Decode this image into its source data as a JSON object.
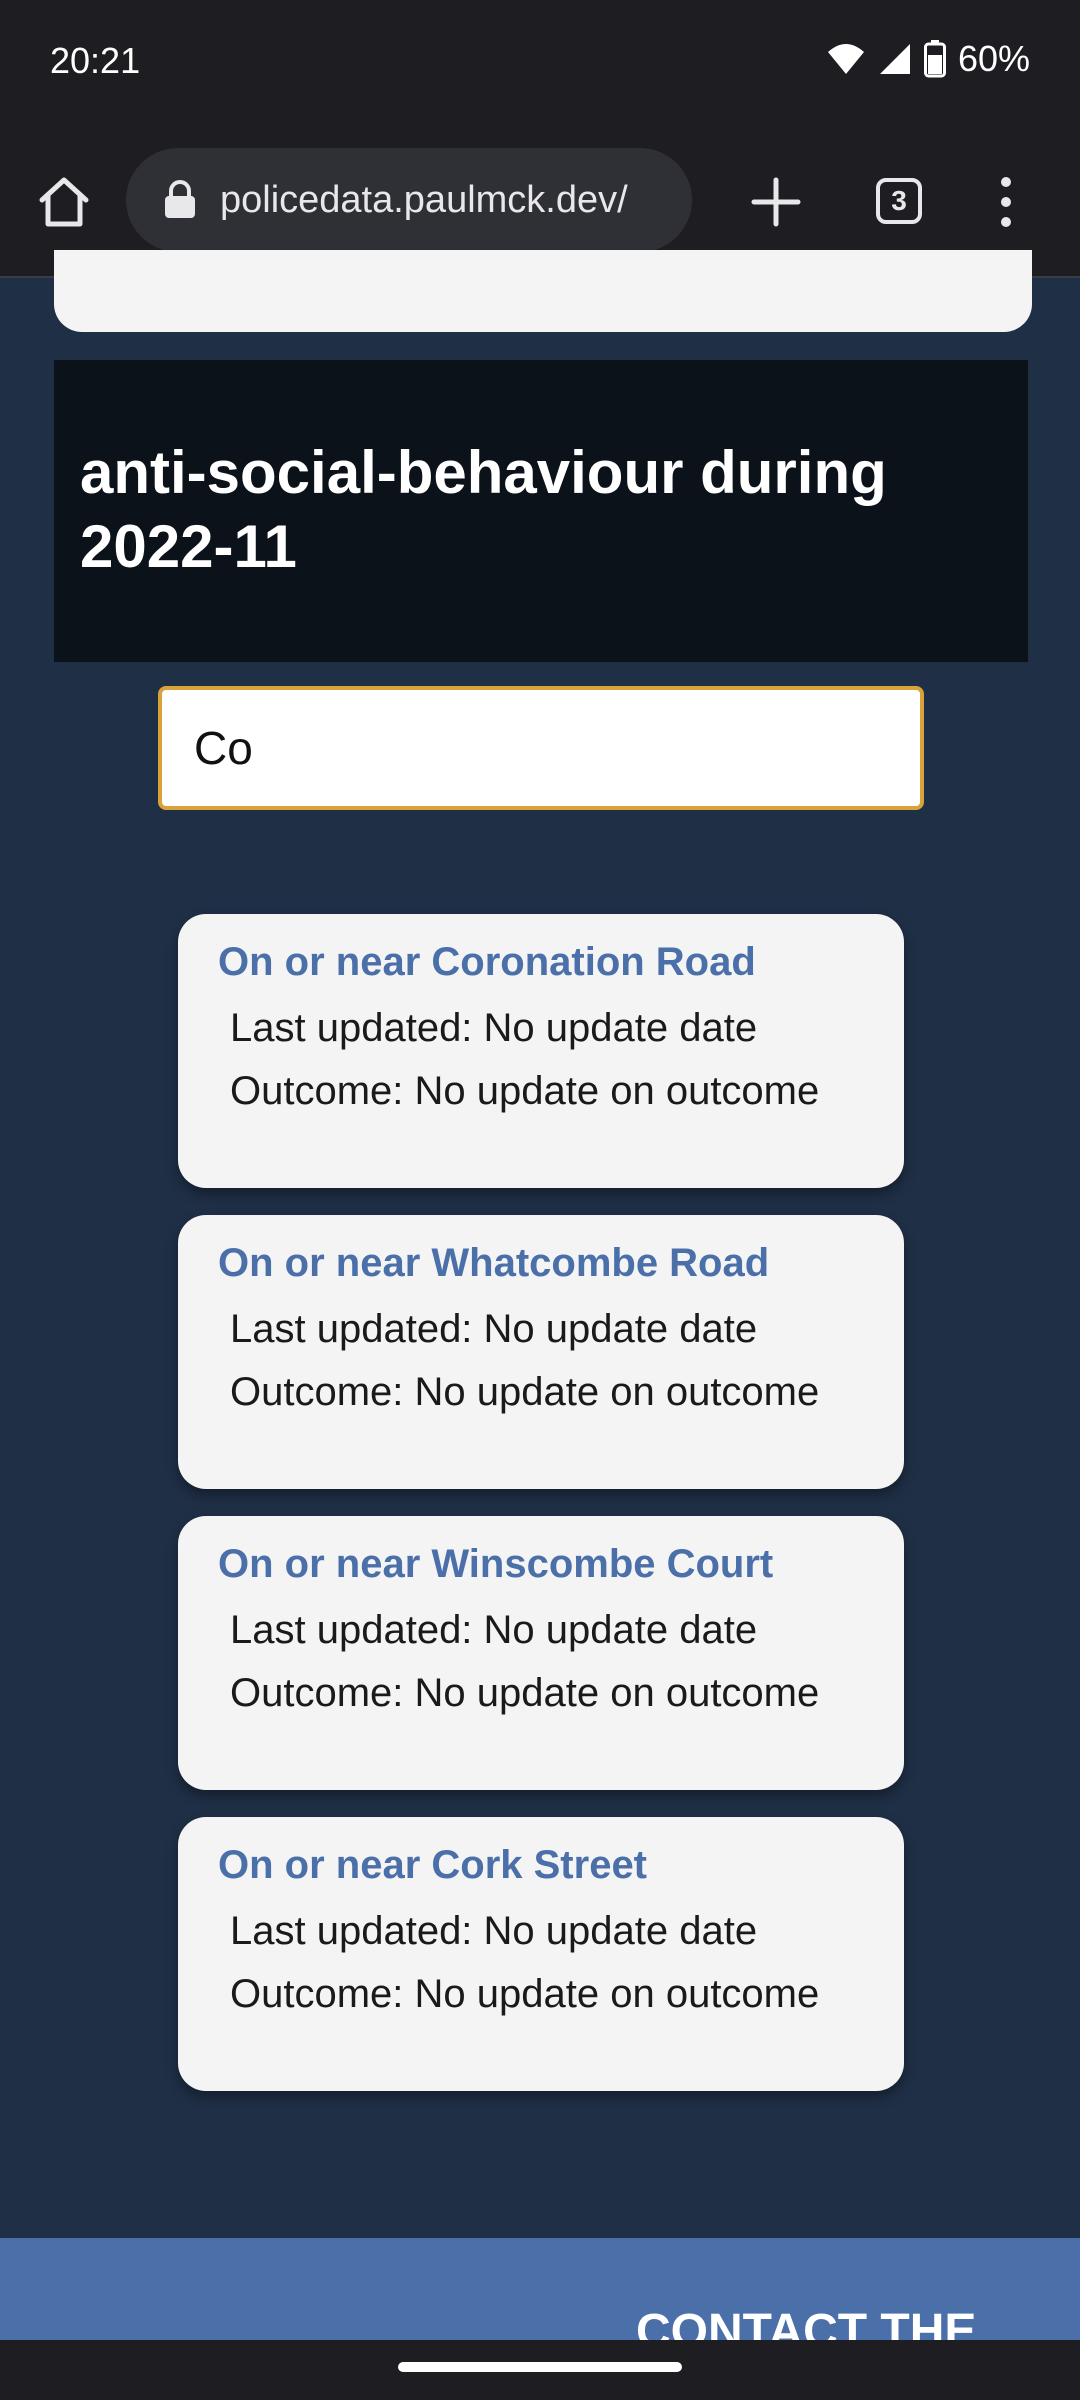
{
  "status_bar": {
    "time": "20:21",
    "battery": "60%",
    "icons": [
      "wifi-icon",
      "signal-icon",
      "battery-icon"
    ]
  },
  "browser": {
    "url": "policedata.paulmck.dev/",
    "tab_count": "3",
    "icons": [
      "home-icon",
      "lock-icon",
      "plus-icon",
      "tabs-icon",
      "more-vert-icon"
    ]
  },
  "page": {
    "heading": "anti-social-behaviour during 2022-11",
    "search": {
      "value": "Co"
    },
    "results": [
      {
        "title": "On or near Coronation Road",
        "updated": "Last updated: No update date",
        "outcome": "Outcome: No update on outcome"
      },
      {
        "title": "On or near Whatcombe Road",
        "updated": "Last updated: No update date",
        "outcome": "Outcome: No update on outcome"
      },
      {
        "title": "On or near Winscombe Court",
        "updated": "Last updated: No update date",
        "outcome": "Outcome: No update on outcome"
      },
      {
        "title": "On or near Cork Street",
        "updated": "Last updated: No update date",
        "outcome": "Outcome: No update on outcome"
      }
    ],
    "footer_title": "CONTACT THE"
  },
  "colors": {
    "page_bg": "#1f2f46",
    "heading_bg": "#0c1219",
    "accent_link": "#4b6fa8",
    "search_border": "#d9a23b",
    "footer_bg": "#4b6fa8"
  }
}
